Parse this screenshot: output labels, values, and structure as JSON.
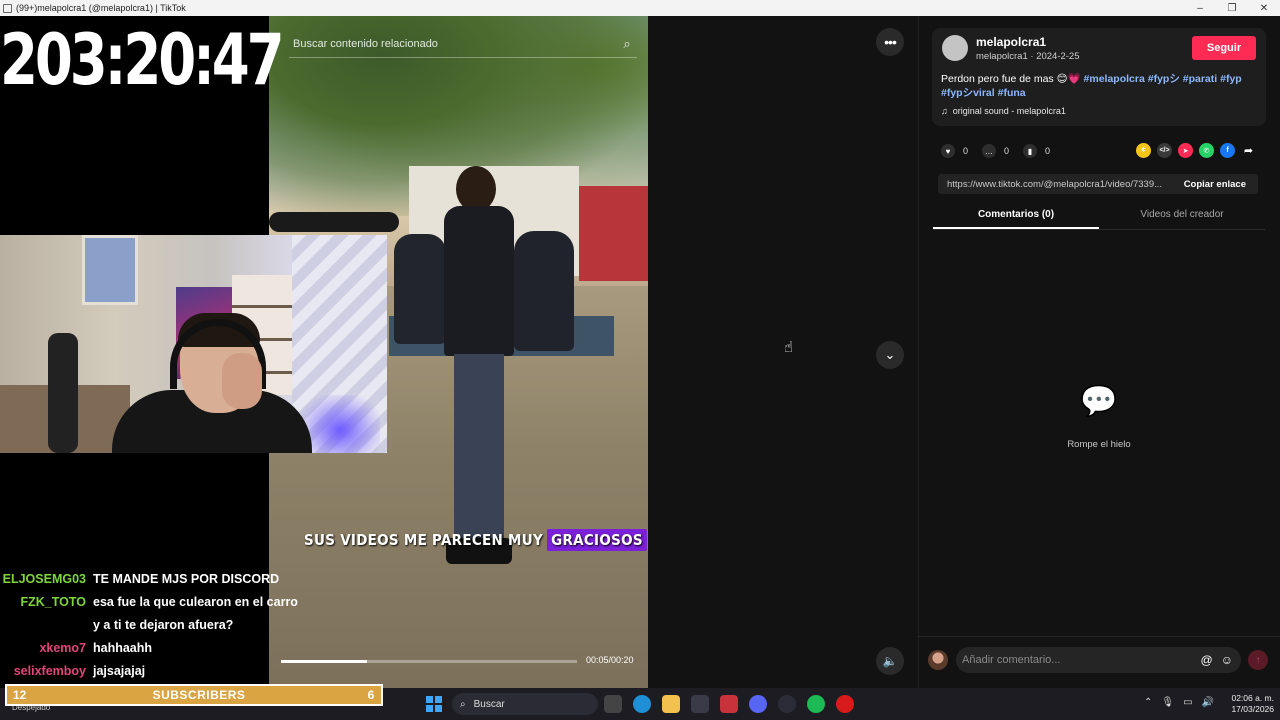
{
  "window": {
    "title": "(99+)melapolcra1 (@melapolcra1) | TikTok",
    "minimize": "–",
    "maximize": "❐",
    "close": "✕"
  },
  "stream": {
    "timer": "203:20:47",
    "chat": [
      {
        "user": "ELJOSEMG03",
        "color": "#7ed63a",
        "msg": "TE MANDE MJS POR DISCORD"
      },
      {
        "user": "FZK_TOTO",
        "color": "#7ed63a",
        "msg": "esa fue la que culearon en el carro"
      },
      {
        "user": "",
        "color": "#7ed63a",
        "msg": "y a ti te dejaron afuera?"
      },
      {
        "user": "xkemo7",
        "color": "#e0457b",
        "msg": "hahhaahh"
      },
      {
        "user": "selixfemboy",
        "color": "#e0457b",
        "msg": "jajsajajaj"
      }
    ],
    "subs": {
      "left": "12",
      "label": "SUBSCRIBERS",
      "right": "6"
    }
  },
  "video": {
    "search_placeholder": "Buscar contenido relacionado",
    "caption_text": "SUS VIDEOS ME PARECEN MUY",
    "caption_highlight": "GRACIOSOS",
    "time": "00:05/00:20",
    "progress": 0.29
  },
  "post": {
    "username": "melapolcra1",
    "subline": "melapolcra1 · 2024-2-25",
    "follow_label": "Seguir",
    "description": "Perdon pero fue de mas 😊💗",
    "hashtags": [
      "#melapolcra",
      "#fypシ",
      "#parati",
      "#fyp",
      "#fypシviral",
      "#funa"
    ],
    "sound": "original sound - melapolcra1",
    "likes": "0",
    "comments": "0",
    "saves": "0",
    "link": "https://www.tiktok.com/@melapolcra1/video/7339...",
    "copy_label": "Copiar enlace"
  },
  "tabs": [
    {
      "label": "Comentarios (0)",
      "active": true
    },
    {
      "label": "Videos del creador",
      "active": false
    }
  ],
  "empty_state": "Rompe el hielo",
  "comment_input": {
    "placeholder": "Añadir comentario..."
  },
  "taskbar": {
    "weather": "Despejado",
    "search_label": "Buscar",
    "time": "02:06 a. m.",
    "date": "17/03/2026"
  },
  "colors": {
    "accent": "#fe2c55",
    "hashtag": "#8bb9ff",
    "subs_bar": "#d9a441",
    "caption_highlight": "#7b1fd8"
  }
}
